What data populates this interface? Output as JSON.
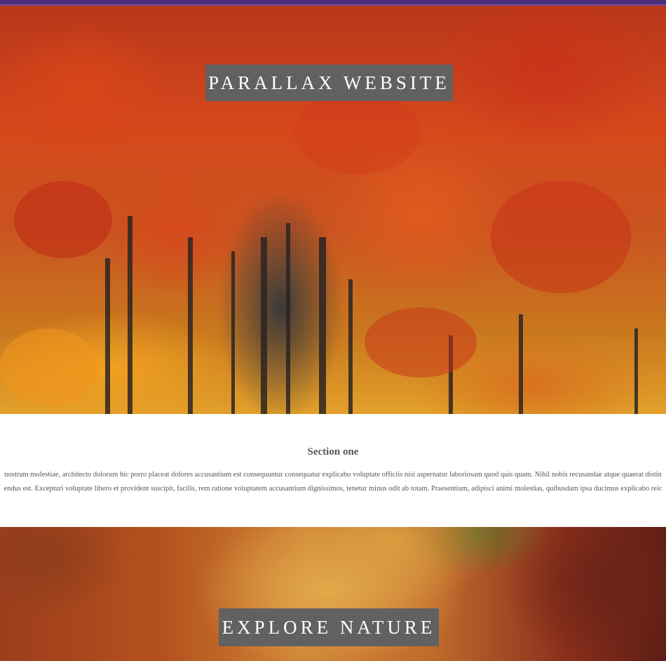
{
  "hero": {
    "title": "PARALLAX WEBSITE"
  },
  "section_one": {
    "heading": "Section one",
    "line1": "nostrum molestiae, architecto dolorum hic porro placeat dolores accusantium est consequuntur consequatur explicabo voluptate officiis nisi aspernatur laboriosam quod quis quam. Nihil nobis recusandae atque quaerat distin",
    "line2": "endus est. Excepturi voluptate libero et provident suscipit, facilis, rem ratione voluptatem accusantium dignissimos, tenetur minus odit ab totam. Praesentium, adipisci animi molestias, quibusdam ipsa ducimus explicabo reic"
  },
  "path_section": {
    "title": "EXPLORE NATURE"
  },
  "colors": {
    "title_box_bg": "#616161",
    "title_text": "#ffffff",
    "body_text": "#555555",
    "top_bar": "#4b2d7a"
  }
}
